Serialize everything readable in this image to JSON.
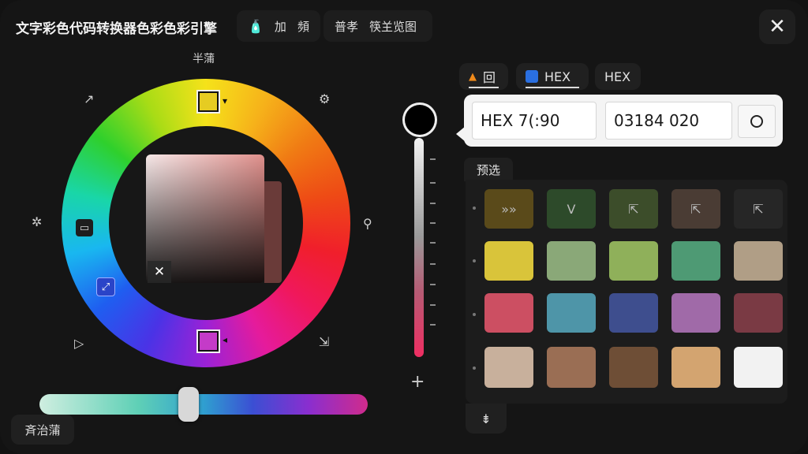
{
  "header": {
    "title": "文字彩色代码转换器色彩色彩引擎",
    "chip1": {
      "icon": "paint-bucket-icon",
      "label_a": "加",
      "label_b": "頻"
    },
    "chip2": {
      "label_a": "普孝",
      "label_b": "筷𦍌览图"
    },
    "close_glyph": "✕"
  },
  "wheel": {
    "top_label": "半蒲",
    "reset_glyph": "✕"
  },
  "hue_slider": {
    "value_fraction": 0.46
  },
  "reset_button": {
    "label": "斉治蒲"
  },
  "value_slider": {
    "plus_glyph": "+",
    "value_fraction": 0.0,
    "swatch_color": "#000000"
  },
  "tabs": [
    {
      "label": "回",
      "icon": "flame-icon",
      "active": true
    },
    {
      "label": "HEX",
      "icon": "blue-square-icon",
      "active": true
    },
    {
      "label": "HEX",
      "icon": "",
      "active": false
    }
  ],
  "hex_panel": {
    "field1_value": "HEX 7(:90",
    "field2_value": "03184 020"
  },
  "presets": {
    "label": "预选",
    "rows": [
      [
        {
          "color": "#5a4a1a",
          "glyph": "»»"
        },
        {
          "color": "#2d4a2a",
          "glyph": "V"
        },
        {
          "color": "#3c4d2a",
          "glyph": "⇱"
        },
        {
          "color": "#4a3c34",
          "glyph": "⇱"
        },
        {
          "color": "#262626",
          "glyph": "⇱"
        }
      ],
      [
        {
          "color": "#d9c43a",
          "glyph": ""
        },
        {
          "color": "#8aa878",
          "glyph": ""
        },
        {
          "color": "#8fb05a",
          "glyph": ""
        },
        {
          "color": "#4e9a74",
          "glyph": ""
        },
        {
          "color": "#b09e86",
          "glyph": ""
        }
      ],
      [
        {
          "color": "#cc4f62",
          "glyph": ""
        },
        {
          "color": "#4e95a8",
          "glyph": ""
        },
        {
          "color": "#3e4e8e",
          "glyph": ""
        },
        {
          "color": "#a06aa8",
          "glyph": ""
        },
        {
          "color": "#7a3a44",
          "glyph": ""
        }
      ],
      [
        {
          "color": "#c8b09c",
          "glyph": ""
        },
        {
          "color": "#9a6e54",
          "glyph": ""
        },
        {
          "color": "#6e4e36",
          "glyph": ""
        },
        {
          "color": "#d3a470",
          "glyph": ""
        },
        {
          "color": "#f2f2f2",
          "glyph": ""
        }
      ]
    ],
    "bottom_button_glyph": "⇟"
  }
}
